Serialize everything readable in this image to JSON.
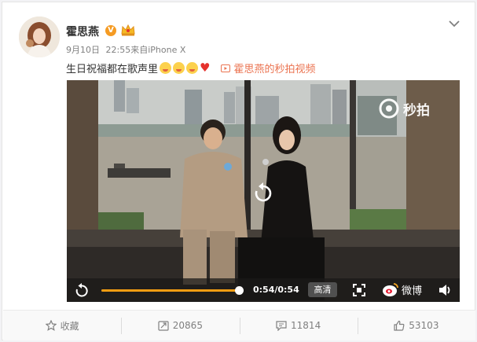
{
  "post": {
    "username": "霍思燕",
    "verified_badge": "V",
    "date": "9月10日",
    "time": "22:55",
    "source": "来自iPhone X",
    "text": "生日祝福都在歌声里",
    "video_link": "霍思燕的秒拍视频"
  },
  "video": {
    "watermark": "秒拍",
    "time_label": "0:54/0:54",
    "progress": 1.0,
    "quality_label": "高清",
    "platform_label": "微博"
  },
  "actions": {
    "favorite": "收藏",
    "repost": "20865",
    "comment": "11814",
    "like": "53103"
  },
  "colors": {
    "accent": "#eb7350",
    "progress": "#f39c12",
    "badge": "#f59b23"
  },
  "icons": {
    "favorite": "star-icon",
    "repost": "repost-icon",
    "comment": "comment-icon",
    "like": "thumbs-up-icon"
  }
}
